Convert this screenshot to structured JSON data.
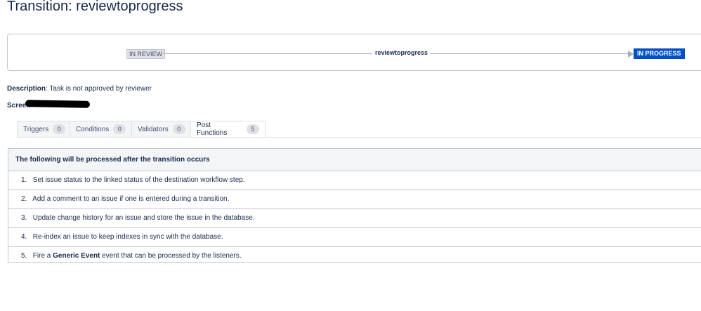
{
  "page": {
    "title": "Transition: reviewtoprogress"
  },
  "diagram": {
    "from_status": "IN REVIEW",
    "transition_name": "reviewtoprogress",
    "to_status": "IN PROGRESS",
    "to_status_color": "#0052cc"
  },
  "details": {
    "description_label": "Description",
    "description_value": ": Task is not approved by reviewer",
    "screen_label": "Screen"
  },
  "tabs": [
    {
      "label": "Triggers",
      "count": "0"
    },
    {
      "label": "Conditions",
      "count": "0"
    },
    {
      "label": "Validators",
      "count": "0"
    },
    {
      "label": "Post Functions",
      "count": "5",
      "active": true
    }
  ],
  "post_functions": {
    "header": "The following will be processed after the transition occurs",
    "items": [
      {
        "num": "1.",
        "text": "Set issue status to the linked status of the destination workflow step."
      },
      {
        "num": "2.",
        "text": "Add a comment to an issue if one is entered during a transition."
      },
      {
        "num": "3.",
        "text": "Update change history for an issue and store the issue in the database."
      },
      {
        "num": "4.",
        "text": "Re-index an issue to keep indexes in sync with the database."
      },
      {
        "num": "5.",
        "pre": "Fire a ",
        "bold": "Generic Event",
        "post": " event that can be processed by the listeners."
      }
    ]
  }
}
